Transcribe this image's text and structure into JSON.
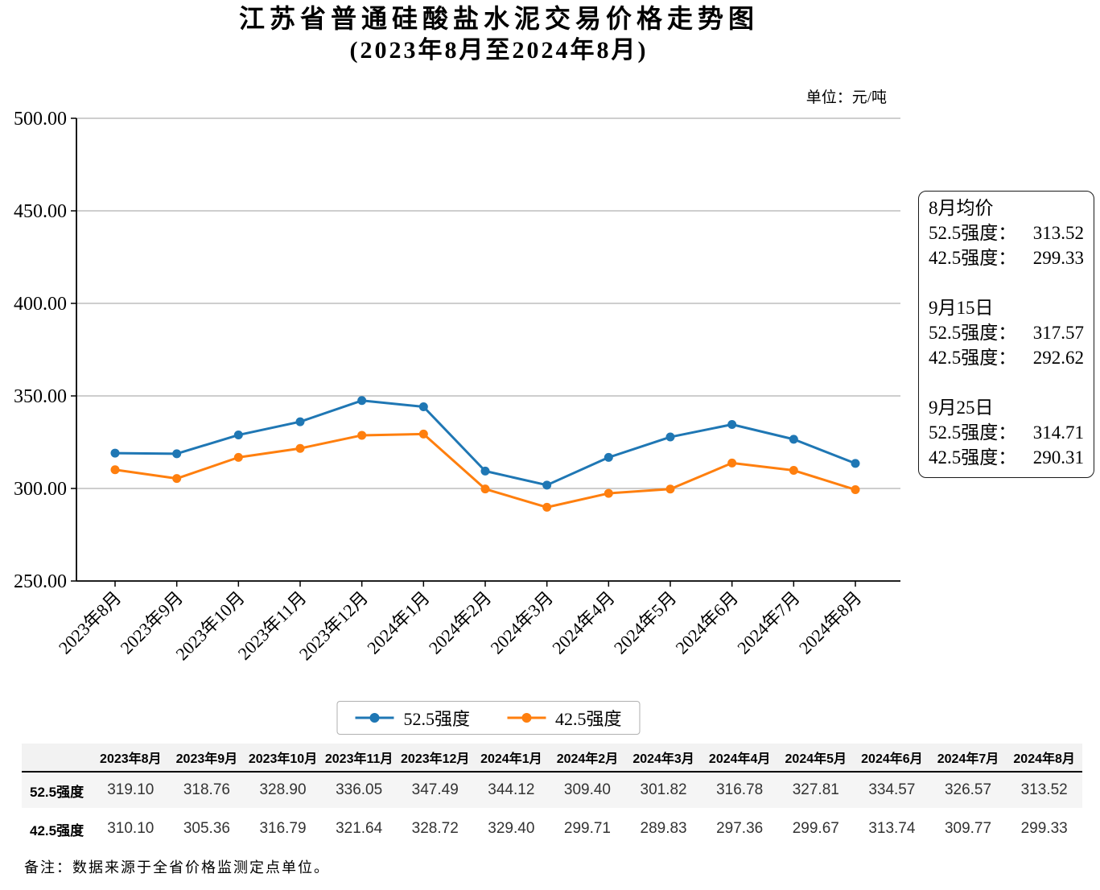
{
  "title": {
    "line1": "江苏省普通硅酸盐水泥交易价格走势图",
    "line2": "(2023年8月至2024年8月)"
  },
  "unit_label": "单位：元/吨",
  "chart_data": {
    "type": "line",
    "categories": [
      "2023年8月",
      "2023年9月",
      "2023年10月",
      "2023年11月",
      "2023年12月",
      "2024年1月",
      "2024年2月",
      "2024年3月",
      "2024年4月",
      "2024年5月",
      "2024年6月",
      "2024年7月",
      "2024年8月"
    ],
    "series": [
      {
        "name": "52.5强度",
        "color": "#1f77b4",
        "values": [
          319.1,
          318.76,
          328.9,
          336.05,
          347.49,
          344.12,
          309.4,
          301.82,
          316.78,
          327.81,
          334.57,
          326.57,
          313.52
        ]
      },
      {
        "name": "42.5强度",
        "color": "#ff7f0e",
        "values": [
          310.1,
          305.36,
          316.79,
          321.64,
          328.72,
          329.4,
          299.71,
          289.83,
          297.36,
          299.67,
          313.74,
          309.77,
          299.33
        ]
      }
    ],
    "ylim": [
      250,
      500
    ],
    "ytick_step": 50,
    "ytick_labels": [
      "250.00",
      "300.00",
      "350.00",
      "400.00",
      "450.00",
      "500.00"
    ],
    "grid": true,
    "grid_color": "#b0b0b0",
    "axis_color": "#000000",
    "legend_position": "bottom"
  },
  "annotation": {
    "sections": [
      {
        "heading": "8月均价",
        "rows": [
          {
            "label": "52.5强度：",
            "value": "313.52"
          },
          {
            "label": "42.5强度：",
            "value": "299.33"
          }
        ]
      },
      {
        "heading": "9月15日",
        "rows": [
          {
            "label": "52.5强度：",
            "value": "317.57"
          },
          {
            "label": "42.5强度：",
            "value": "292.62"
          }
        ]
      },
      {
        "heading": "9月25日",
        "rows": [
          {
            "label": "52.5强度：",
            "value": "314.71"
          },
          {
            "label": "42.5强度：",
            "value": "290.31"
          }
        ]
      }
    ]
  },
  "legend": {
    "items": [
      {
        "label": "52.5强度",
        "color": "#1f77b4"
      },
      {
        "label": "42.5强度",
        "color": "#ff7f0e"
      }
    ]
  },
  "table": {
    "corner_label": "",
    "columns": [
      "2023年8月",
      "2023年9月",
      "2023年10月",
      "2023年11月",
      "2023年12月",
      "2024年1月",
      "2024年2月",
      "2024年3月",
      "2024年4月",
      "2024年5月",
      "2024年6月",
      "2024年7月",
      "2024年8月"
    ],
    "rows": [
      {
        "label": "52.5强度",
        "values": [
          "319.10",
          "318.76",
          "328.90",
          "336.05",
          "347.49",
          "344.12",
          "309.40",
          "301.82",
          "316.78",
          "327.81",
          "334.57",
          "326.57",
          "313.52"
        ]
      },
      {
        "label": "42.5强度",
        "values": [
          "310.10",
          "305.36",
          "316.79",
          "321.64",
          "328.72",
          "329.40",
          "299.71",
          "289.83",
          "297.36",
          "299.67",
          "313.74",
          "309.77",
          "299.33"
        ]
      }
    ]
  },
  "footnote": "备注：数据来源于全省价格监测定点单位。"
}
